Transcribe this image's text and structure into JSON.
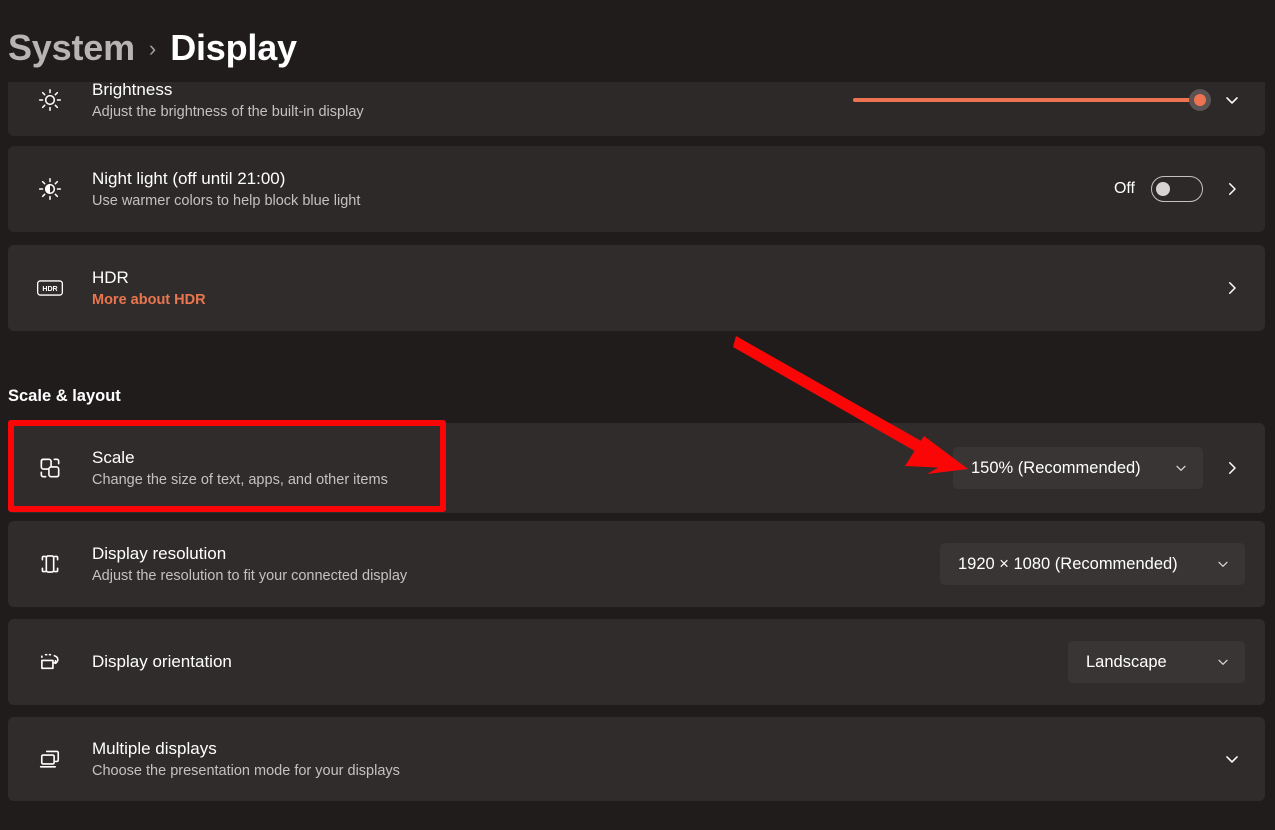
{
  "breadcrumb": {
    "parent": "System",
    "separator": "›",
    "current": "Display"
  },
  "colors": {
    "page_background": "#201c1c",
    "card_background": "#2d2929",
    "accent": "#ed7351",
    "link": "#e8764f",
    "annotation_red": "#fb0606",
    "text_primary": "#ffffff",
    "text_secondary": "#c6c1c1"
  },
  "settings": {
    "brightness": {
      "title": "Brightness",
      "subtitle": "Adjust the brightness of the built-in display",
      "icon": "brightness-icon",
      "slider_value": "97",
      "expand_icon": "chevron-down-icon"
    },
    "night_light": {
      "title": "Night light (off until 21:00)",
      "subtitle": "Use warmer colors to help block blue light",
      "icon": "night-light-icon",
      "toggle_state": "Off",
      "chevron": "chevron-right-icon"
    },
    "hdr": {
      "title": "HDR",
      "subtitle": "More about HDR",
      "icon": "hdr-icon",
      "chevron": "chevron-right-icon"
    }
  },
  "scale_layout": {
    "heading": "Scale & layout",
    "scale": {
      "title": "Scale",
      "subtitle": "Change the size of text, apps, and other items",
      "icon": "scale-icon",
      "value": "150% (Recommended)",
      "dropdown_icon": "chevron-down-icon",
      "chevron": "chevron-right-icon",
      "highlighted": "true"
    },
    "display_resolution": {
      "title": "Display resolution",
      "subtitle": "Adjust the resolution to fit your connected display",
      "icon": "display-resolution-icon",
      "value": "1920 × 1080 (Recommended)",
      "dropdown_icon": "chevron-down-icon"
    },
    "display_orientation": {
      "title": "Display orientation",
      "subtitle": "",
      "icon": "display-orientation-icon",
      "value": "Landscape",
      "dropdown_icon": "chevron-down-icon"
    },
    "multiple_displays": {
      "title": "Multiple displays",
      "subtitle": "Choose the presentation mode for your displays",
      "icon": "multiple-displays-icon",
      "expand_icon": "chevron-down-icon"
    }
  }
}
